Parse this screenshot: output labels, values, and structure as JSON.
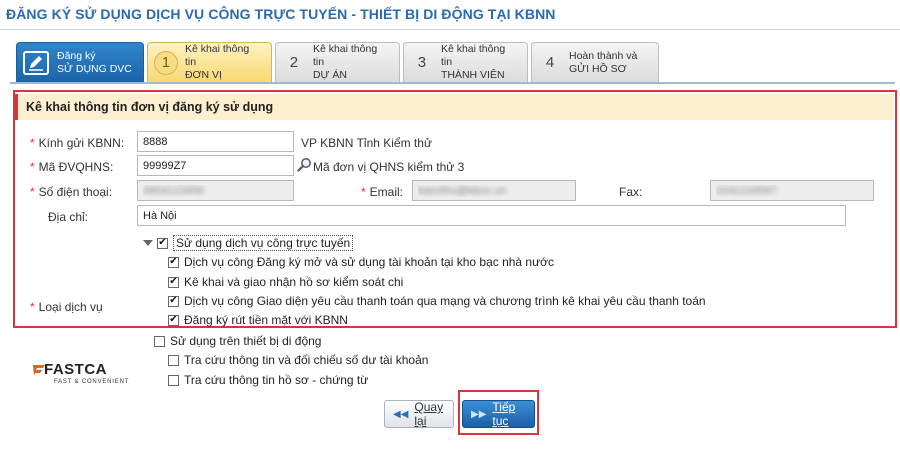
{
  "page_title": "ĐĂNG KÝ SỬ DỤNG DỊCH VỤ CÔNG TRỰC TUYẾN - THIẾT BỊ DI ĐỘNG TẠI KBNN",
  "steps": [
    {
      "num": "",
      "line1": "Đăng ký",
      "line2": "SỬ DỤNG DVC",
      "icon": "edit-icon"
    },
    {
      "num": "1",
      "line1": "Kê khai thông tin",
      "line2": "ĐƠN VỊ"
    },
    {
      "num": "2",
      "line1": "Kê khai thông tin",
      "line2": "DỰ ÁN"
    },
    {
      "num": "3",
      "line1": "Kê khai thông tin",
      "line2": "THÀNH VIÊN"
    },
    {
      "num": "4",
      "line1": "Hoàn thành và",
      "line2": "GỬI HỒ SƠ"
    }
  ],
  "panel": {
    "title": "Kê khai thông tin đơn vị đăng ký sử dụng"
  },
  "form": {
    "kbnn_label": "Kính gửi KBNN:",
    "kbnn_value": "8888",
    "kbnn_name": "VP KBNN Tỉnh Kiểm thử",
    "dvqhns_label": "Mã ĐVQHNS:",
    "dvqhns_value": "99999Z7",
    "dvqhns_name": "Mã đơn vị QHNS kiểm thử 3",
    "phone_label": "Số điện thoại:",
    "phone_value": "0904123456",
    "email_label": "Email:",
    "email_value": "kiemthu@kbnn.vn",
    "fax_label": "Fax:",
    "fax_value": "0241234567",
    "address_label": "Địa chỉ:",
    "address_value": "Hà Nội",
    "service_label": "Loại dịch vụ"
  },
  "services": {
    "online": {
      "label": "Sử dụng dịch vụ công trực tuyến",
      "checked": true,
      "items": [
        {
          "label": "Dịch vụ công Đăng ký mở và sử dụng tài khoản tại kho bạc nhà nước",
          "checked": true
        },
        {
          "label": "Kê khai và giao nhận hồ sơ kiểm soát chi",
          "checked": true
        },
        {
          "label": "Dịch vụ công Giao diện yêu cầu thanh toán qua mạng và chương trình kê khai yêu cầu thanh toán",
          "checked": true
        },
        {
          "label": "Đăng ký rút tiền mặt với KBNN",
          "checked": true
        }
      ]
    },
    "mobile": {
      "label": "Sử dụng trên thiết bị di động",
      "checked": false,
      "items": [
        {
          "label": "Tra cứu thông tin và đối chiếu số dư tài khoản",
          "checked": false
        },
        {
          "label": "Tra cứu thông tin hồ sơ - chứng từ",
          "checked": false
        }
      ]
    }
  },
  "logo": {
    "brand": "FASTCA",
    "tagline": "FAST & CONVENIENT"
  },
  "buttons": {
    "back": "Quay lại",
    "next": "Tiếp tục"
  },
  "colors": {
    "accent": "#2a6ab0",
    "highlight": "#d9333f",
    "active_step": "#f7d872"
  }
}
